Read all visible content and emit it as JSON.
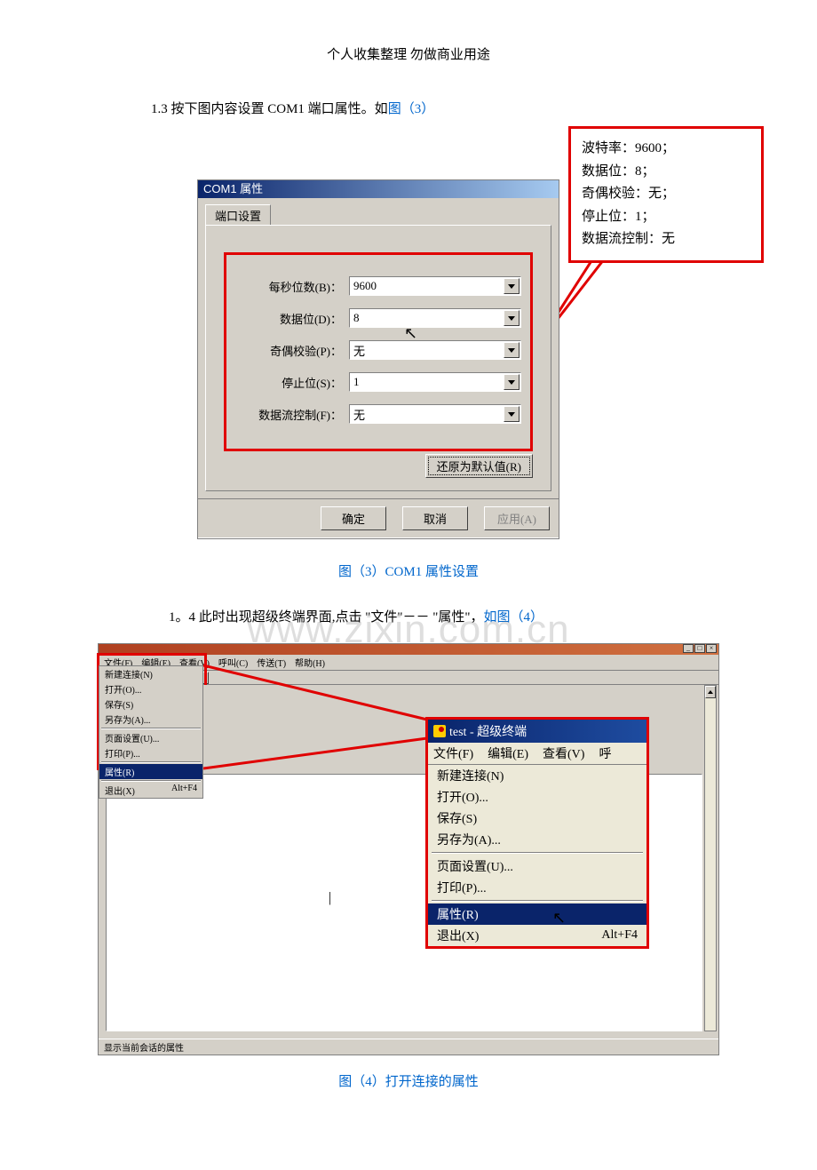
{
  "header": "个人收集整理  勿做商业用途",
  "section1": {
    "text_prefix": "1.3  按下图内容设置 COM1 端口属性。如",
    "figref": "图（3）"
  },
  "callout": {
    "line1": "波特率：9600；",
    "line2": "数据位：8；",
    "line3": "奇偶校验：无；",
    "line4": "停止位：1；",
    "line5": "数据流控制：无"
  },
  "dialog": {
    "title": "COM1 属性",
    "tab": "端口设置",
    "fields": {
      "baud_label": "每秒位数(B)：",
      "baud_value": "9600",
      "data_label": "数据位(D)：",
      "data_value": "8",
      "parity_label": "奇偶校验(P)：",
      "parity_value": "无",
      "stop_label": "停止位(S)：",
      "stop_value": "1",
      "flow_label": "数据流控制(F)：",
      "flow_value": "无"
    },
    "restore": "还原为默认值(R)",
    "ok": "确定",
    "cancel": "取消",
    "apply": "应用(A)"
  },
  "caption3": "图（3）COM1 属性设置",
  "section2": {
    "text_prefix": "1。4  此时出现超级终端界面,点击 \"文件\"－－ \"属性\"，",
    "figref": "如图（4）"
  },
  "watermark": "www.zixin.com.cn",
  "smallmenu": {
    "bar": {
      "file": "文件(F)",
      "edit": "编辑(E)",
      "view": "查看(V)",
      "call": "呼叫(C)",
      "transfer": "传送(T)",
      "help": "帮助(H)"
    },
    "items": {
      "new": "新建连接(N)",
      "open": "打开(O)...",
      "save": "保存(S)",
      "saveas": "另存为(A)...",
      "pagesetup": "页面设置(U)...",
      "print": "打印(P)...",
      "prop": "属性(R)",
      "exit": "退出(X)",
      "exit_sc": "Alt+F4"
    }
  },
  "enlarged": {
    "title": "test - 超级终端",
    "bar": {
      "file": "文件(F)",
      "edit": "编辑(E)",
      "view": "查看(V)",
      "call": "呼"
    },
    "items": {
      "new": "新建连接(N)",
      "open": "打开(O)...",
      "save": "保存(S)",
      "saveas": "另存为(A)...",
      "pagesetup": "页面设置(U)...",
      "print": "打印(P)...",
      "prop": "属性(R)",
      "exit": "退出(X)",
      "exit_sc": "Alt+F4"
    }
  },
  "statusbar": "显示当前会话的属性",
  "caption4": "图（4）打开连接的属性"
}
